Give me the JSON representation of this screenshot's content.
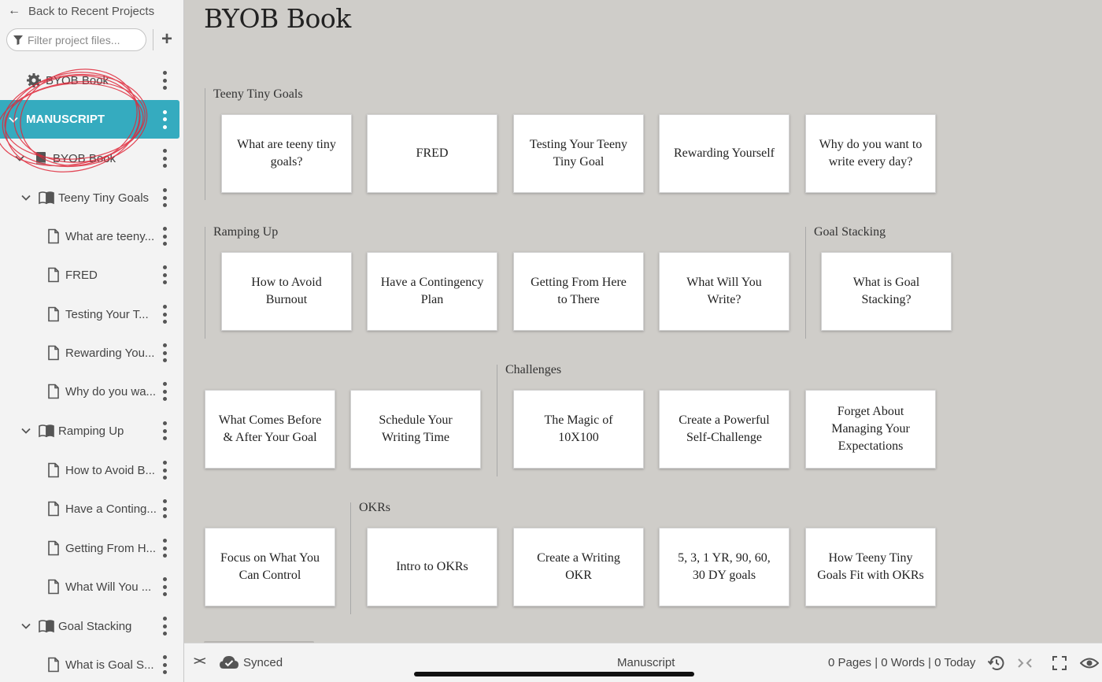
{
  "sidebar": {
    "back_label": "Back to Recent Projects",
    "filter_placeholder": "Filter project files...",
    "items": [
      {
        "label": "BYOB Book",
        "icon": "gear-icon"
      },
      {
        "label": "MANUSCRIPT",
        "selected": true
      },
      {
        "label": "BYOB Book",
        "icon": "book-icon"
      },
      {
        "label": "Teeny Tiny Goals",
        "icon": "open-book-icon"
      },
      {
        "label": "What are teeny...",
        "icon": "document-icon"
      },
      {
        "label": "FRED",
        "icon": "document-icon"
      },
      {
        "label": "Testing Your T...",
        "icon": "document-icon"
      },
      {
        "label": "Rewarding You...",
        "icon": "document-icon"
      },
      {
        "label": "Why do you wa...",
        "icon": "document-icon"
      },
      {
        "label": "Ramping Up",
        "icon": "open-book-icon"
      },
      {
        "label": "How to Avoid B...",
        "icon": "document-icon"
      },
      {
        "label": "Have a Conting...",
        "icon": "document-icon"
      },
      {
        "label": "Getting From H...",
        "icon": "document-icon"
      },
      {
        "label": "What Will You ...",
        "icon": "document-icon"
      },
      {
        "label": "Goal Stacking",
        "icon": "open-book-icon"
      },
      {
        "label": "What is Goal S...",
        "icon": "document-icon"
      }
    ]
  },
  "main": {
    "title": "BYOB Book",
    "groups": {
      "teeny": "Teeny Tiny Goals",
      "ramping": "Ramping Up",
      "stacking": "Goal Stacking",
      "challenges": "Challenges",
      "okrs": "OKRs"
    },
    "cards": [
      "What are teeny tiny goals?",
      "FRED",
      "Testing Your Teeny Tiny Goal",
      "Rewarding Yourself",
      "Why do you want to write every day?",
      "How to Avoid Burnout",
      "Have a Contingency Plan",
      "Getting From Here to There",
      "What Will You Write?",
      "What is Goal Stacking?",
      "What Comes Before & After Your Goal",
      "Schedule Your Writing Time",
      "The Magic of 10X100",
      "Create a Powerful Self-Challenge",
      "Forget About Managing Your Expectations",
      "Focus on What You Can Control",
      "Intro to OKRs",
      "Create a Writing OKR",
      "5, 3, 1 YR, 90, 60, 30 DY goals",
      "How Teeny Tiny Goals Fit with OKRs"
    ]
  },
  "statusbar": {
    "sync_label": "Synced",
    "center_label": "Manuscript",
    "stats": "0 Pages | 0 Words | 0 Today"
  },
  "colors": {
    "accent": "#35abbf",
    "canvas": "#cfcdc9",
    "annotation": "#e0283a"
  }
}
